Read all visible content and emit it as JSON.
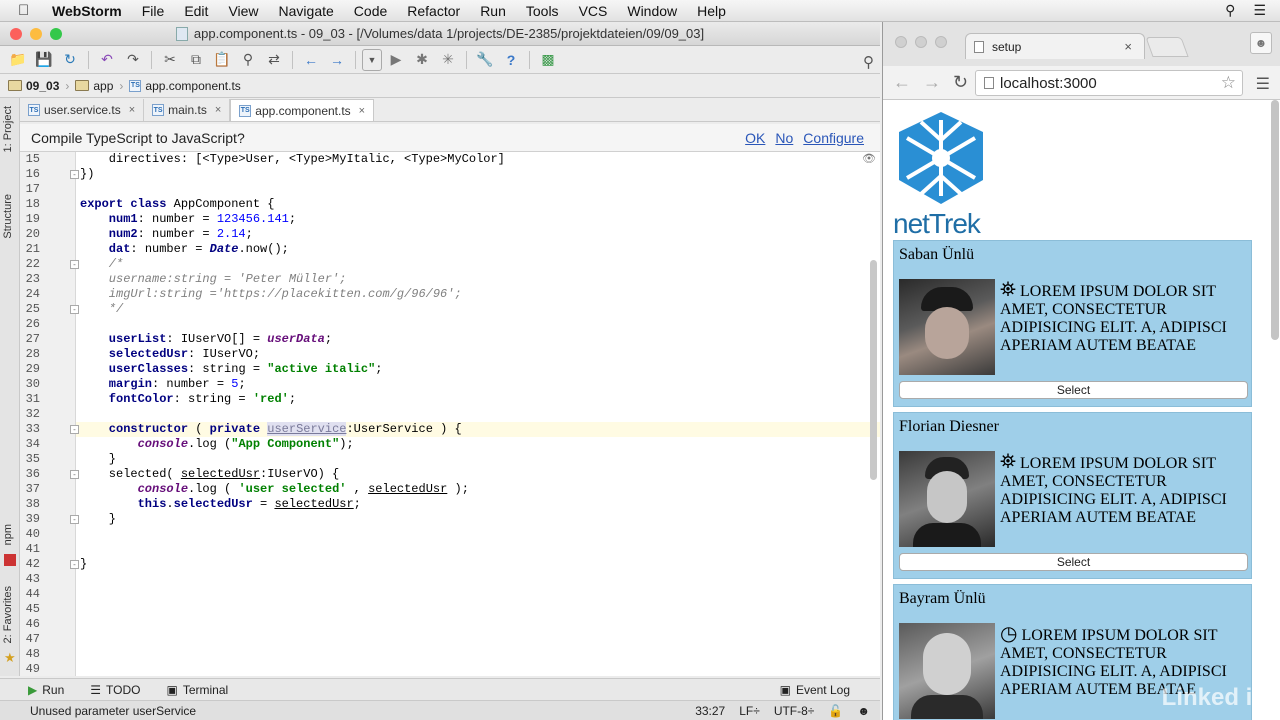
{
  "menubar": {
    "app": "WebStorm",
    "items": [
      "File",
      "Edit",
      "View",
      "Navigate",
      "Code",
      "Refactor",
      "Run",
      "Tools",
      "VCS",
      "Window",
      "Help"
    ]
  },
  "ide": {
    "title": "app.component.ts - 09_03 - [/Volumes/data 1/projects/DE-2385/projektdateien/09/09_03]",
    "breadcrumb": [
      "09_03",
      "app",
      "app.component.ts"
    ],
    "tabs": [
      {
        "label": "user.service.ts"
      },
      {
        "label": "main.ts"
      },
      {
        "label": "app.component.ts",
        "active": true
      }
    ],
    "side_labels": {
      "project": "1: Project",
      "structure": "Structure",
      "npm": "npm",
      "favorites": "2: Favorites"
    },
    "notification": {
      "text": "Compile TypeScript to JavaScript?",
      "ok": "OK",
      "no": "No",
      "configure": "Configure"
    },
    "line_numbers": [
      "15",
      "16",
      "17",
      "18",
      "19",
      "20",
      "21",
      "22",
      "23",
      "24",
      "25",
      "26",
      "27",
      "28",
      "29",
      "30",
      "31",
      "32",
      "33",
      "34",
      "35",
      "36",
      "37",
      "38",
      "39",
      "40",
      "41",
      "42",
      "43",
      "44",
      "45",
      "46",
      "47",
      "48",
      "49"
    ],
    "code": {
      "l15": "    directives: [<Type>User, <Type>MyItalic, <Type>MyColor]",
      "l16": "})",
      "l18a": "export class",
      "l18b": " AppComponent {",
      "l19a": "    num1",
      "l19b": ": number = ",
      "l19c": "123456.141",
      "l19d": ";",
      "l20a": "    num2",
      "l20b": ": number = ",
      "l20c": "2.14",
      "l20d": ";",
      "l21a": "    dat",
      "l21b": ": number = ",
      "l21c": "Date",
      "l21d": ".now();",
      "l22": "    /*",
      "l23": "    username:string = 'Peter Müller';",
      "l24": "    imgUrl:string ='https://placekitten.com/g/96/96';",
      "l25": "    */",
      "l27a": "    userList",
      "l27b": ": IUserVO[] = ",
      "l27c": "userData",
      "l27d": ";",
      "l28a": "    selectedUsr",
      "l28b": ": IUserVO;",
      "l29a": "    userClasses",
      "l29b": ": string = ",
      "l29c": "\"active italic\"",
      "l29d": ";",
      "l30a": "    margin",
      "l30b": ": number = ",
      "l30c": "5",
      "l30d": ";",
      "l31a": "    fontColor",
      "l31b": ": string = ",
      "l31c": "'red'",
      "l31d": ";",
      "l33a": "    constructor",
      "l33b": " ( ",
      "l33c": "private",
      "l33d": " ",
      "l33e": "userService",
      "l33f": ":UserService ) {",
      "l34a": "        console",
      "l34b": ".log (",
      "l34c": "\"App Component\"",
      "l34d": ");",
      "l35": "    }",
      "l36a": "    selected( ",
      "l36b": "selectedUsr",
      "l36c": ":IUserVO) {",
      "l37a": "        console",
      "l37b": ".log ( ",
      "l37c": "'user selected'",
      "l37d": " , ",
      "l37e": "selectedUsr",
      "l37f": " );",
      "l38a": "        this",
      "l38b": ".",
      "l38c": "selectedUsr",
      "l38d": " = ",
      "l38e": "selectedUsr",
      "l38f": ";",
      "l39": "    }",
      "l42": "}"
    },
    "toolwindows": {
      "run": "Run",
      "todo": "TODO",
      "terminal": "Terminal",
      "eventlog": "Event Log"
    },
    "status": {
      "message": "Unused parameter userService",
      "position": "33:27",
      "line_sep": "LF÷",
      "encoding": "UTF-8÷"
    }
  },
  "browser": {
    "tab_title": "setup",
    "url": "localhost:3000",
    "logo_text": "netTrek",
    "cards": [
      {
        "name": "Saban Ünlü",
        "desc": "LOREM IPSUM DOLOR SIT AMET, CONSECTETUR ADIPISICING ELIT. A, ADIPISCI APERIAM AUTEM BEATAE",
        "button": "Select",
        "icon": "hiker-icon"
      },
      {
        "name": "Florian Diesner",
        "desc": "LOREM IPSUM DOLOR SIT AMET, CONSECTETUR ADIPISICING ELIT. A, ADIPISCI APERIAM AUTEM BEATAE",
        "button": "Select",
        "icon": "hiker-icon"
      },
      {
        "name": "Bayram Ünlü",
        "desc": "LOREM IPSUM DOLOR SIT AMET, CONSECTETUR ADIPISICING ELIT. A, ADIPISCI APERIAM AUTEM BEATAE",
        "icon": "clock-icon"
      }
    ],
    "watermark": "Linked in"
  },
  "colors": {
    "card_bg": "#9fcfe9",
    "logo_blue": "#2a8fd4",
    "keyword": "#000080",
    "string": "#008000",
    "field": "#660e7a"
  }
}
